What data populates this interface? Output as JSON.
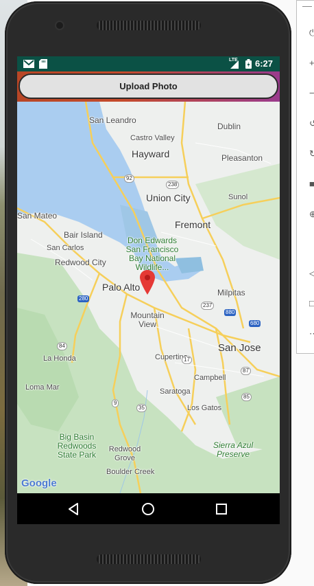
{
  "status_bar": {
    "time": "6:27",
    "network_label": "LTE",
    "left_icons": [
      "gmail-icon",
      "sd-card-icon"
    ],
    "right_icons": [
      "signal-icon",
      "battery-icon"
    ],
    "color": "#0b5145"
  },
  "app": {
    "upload_button_label": "Upload Photo"
  },
  "map": {
    "places": {
      "san_leandro": "San Leandro",
      "castro_valley": "Castro Valley",
      "dublin": "Dublin",
      "hayward": "Hayward",
      "pleasanton": "Pleasanton",
      "union_city": "Union City",
      "sunol": "Sunol",
      "san_mateo": "San Mateo",
      "bair_island": "Bair Island",
      "fremont": "Fremont",
      "san_carlos": "San Carlos",
      "redwood_city": "Redwood City",
      "palo_alto": "Palo Alto",
      "milpitas": "Milpitas",
      "mountain_view": "Mountain View",
      "san_jose": "San Jose",
      "la_honda": "La Honda",
      "cupertino": "Cupertino",
      "campbell": "Campbell",
      "loma_mar": "Loma Mar",
      "saratoga": "Saratoga",
      "los_gatos": "Los Gatos",
      "redwood_grove": "Redwood Grove",
      "boulder_creek": "Boulder Creek"
    },
    "parks": {
      "don_edwards": "Don Edwards San Francisco Bay National Wildlife...",
      "big_basin": "Big Basin Redwoods State Park",
      "sierra_azul": "Sierra Azul Preserve"
    },
    "highways": [
      "92",
      "238",
      "84",
      "280",
      "237",
      "880",
      "680",
      "87",
      "85",
      "9",
      "35",
      "17"
    ],
    "attribution": "Google"
  },
  "nav": {
    "back": "back-icon",
    "home": "home-icon",
    "recents": "recents-icon"
  }
}
